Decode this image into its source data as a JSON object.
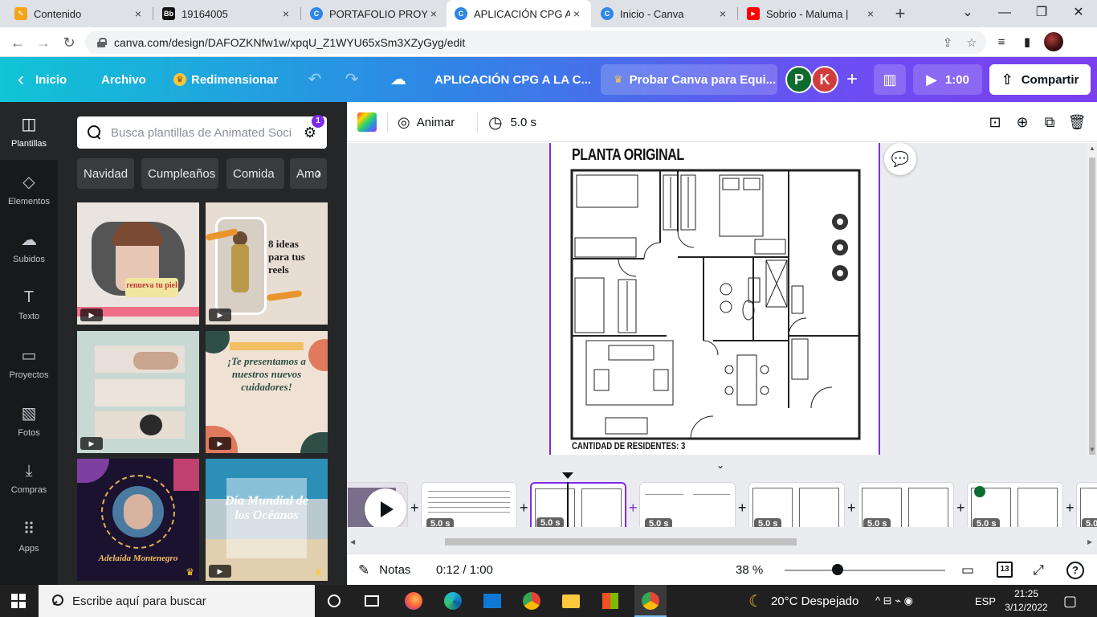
{
  "browser": {
    "tabs": [
      {
        "title": "Contenido",
        "favicon": "pencil-favicon",
        "color": "#f4a31b"
      },
      {
        "title": "19164005",
        "favicon": "bb-favicon",
        "color": "#111111"
      },
      {
        "title": "PORTAFOLIO PROYEC",
        "favicon": "canva-favicon",
        "color": "#2f86e6"
      },
      {
        "title": "APLICACIÓN CPG A LA",
        "favicon": "canva-favicon",
        "color": "#2f86e6",
        "active": true
      },
      {
        "title": "Inicio - Canva",
        "favicon": "canva-favicon",
        "color": "#2f86e6"
      },
      {
        "title": "Sobrio - Maluma |",
        "favicon": "youtube-favicon",
        "color": "#ff0000"
      }
    ],
    "favicon_letters": {
      "bb": "Bb",
      "canva": "C",
      "youtube": "▶",
      "pencil": "✎"
    },
    "tab_close": "×",
    "new_tab": "+",
    "url": "canva.com/design/DAFOZKNfw1w/xpqU_Z1WYU65xSm3XZyGyg/edit",
    "window_controls": {
      "dropdown": "⌄",
      "minimize": "—",
      "maximize": "❐",
      "close": "✕"
    },
    "nav": {
      "back": "←",
      "forward": "→",
      "reload": "↻"
    },
    "omnibox_icons": {
      "share": "⇪",
      "star": "☆"
    },
    "extensions": {
      "media": "≡",
      "sidepanel": "▮"
    }
  },
  "header": {
    "back_label": "Inicio",
    "back_arrow": "‹",
    "file_label": "Archivo",
    "resize_label": "Redimensionar",
    "crown": "♛",
    "undo": "↶",
    "redo": "↷",
    "cloud": "☁",
    "design_title": "APLICACIÓN CPG A LA C...",
    "try_label": "Probar Canva para Equi...",
    "avatars": [
      {
        "letter": "P",
        "color": "#0e6b2f"
      },
      {
        "letter": "K",
        "color": "#d13c3c"
      }
    ],
    "add_people": "+",
    "stats_icon": "▥",
    "play_time": "1:00",
    "play_icon": "▶",
    "share_label": "Compartir",
    "share_icon": "⇧"
  },
  "rail": {
    "items": [
      {
        "label": "Plantillas",
        "icon": "◫",
        "active": true
      },
      {
        "label": "Elementos",
        "icon": "◇"
      },
      {
        "label": "Subidos",
        "icon": "☁"
      },
      {
        "label": "Texto",
        "icon": "T"
      },
      {
        "label": "Proyectos",
        "icon": "▭"
      },
      {
        "label": "Fotos",
        "icon": "▧"
      },
      {
        "label": "Compras",
        "icon": "⤓"
      },
      {
        "label": "Apps",
        "icon": "⠿"
      }
    ]
  },
  "panel": {
    "search_placeholder": "Busca plantillas de Animated Soci",
    "filter_icon": "⚙",
    "filter_badge": "1",
    "chips": [
      "Navidad",
      "Cumpleaños",
      "Comida",
      "Amo"
    ],
    "chip_arrow": "›",
    "video_icon": "▶",
    "pro_icon": "♛",
    "templates": [
      {
        "text": "renueva tu piel",
        "bg": "#e9e4df"
      },
      {
        "text": "8 ideas para tus reels",
        "bg": "#e8ddd2"
      },
      {
        "text": "",
        "bg": "#c8d8d3"
      },
      {
        "text": "¡Te presentamos a nuestros nuevos cuidadores!",
        "bg": "#efe2d4"
      },
      {
        "text": "Adelaida Montenegro",
        "bg": "#1b1230"
      },
      {
        "text": "Día Mundial de los Océanos",
        "bg": "#b9c9cf"
      }
    ],
    "collapse_arrow": "‹"
  },
  "toolbar": {
    "animate_label": "Animar",
    "animate_icon": "◎",
    "duration": "5.0 s",
    "clock_icon": "◷",
    "lock_icon": "⊡",
    "add_page_icon": "⊕",
    "duplicate_icon": "⧉",
    "delete_icon": "🗑"
  },
  "canvas": {
    "plan_title": "PLANTA ORIGINAL",
    "plan_caption": "CANTIDAD DE RESIDENTES: 3",
    "comment_icon": "💬",
    "scroll_up": "▲",
    "scroll_down": "▼"
  },
  "timeline": {
    "collapse_arrow": "⌄",
    "scenes": [
      {
        "duration": "5.0 s"
      },
      {
        "duration": "5.0 s",
        "active": true
      },
      {
        "duration": "5.0 s"
      },
      {
        "duration": "5.0 s"
      },
      {
        "duration": "5.0 s"
      },
      {
        "duration": "5.0 s"
      },
      {
        "duration": "5.0"
      }
    ],
    "add_icon": "+",
    "scroll_left": "◀",
    "scroll_right": "▶"
  },
  "bottom": {
    "notes_label": "Notas",
    "notes_icon": "✎",
    "time_label": "0:12 / 1:00",
    "zoom_label": "38 %",
    "zoom_value": 0.38,
    "page_count": "13",
    "grid_icon": "▭",
    "fullscreen_icon": "⤢",
    "help_icon": "?"
  },
  "taskbar": {
    "search_text": "Escribe aquí para buscar",
    "weather": "20°C  Despejado",
    "weather_icon": "☾",
    "language": "ESP",
    "time": "21:25",
    "date": "3/12/2022",
    "tray_icons": "^  ⊟  ⌁  ◉",
    "notification_icon": "▢",
    "apps": [
      "cortana-icon",
      "task-view-icon",
      "firefox-icon",
      "edge-icon",
      "mail-icon",
      "chrome-icon",
      "explorer-icon",
      "store-icon",
      "chrome-profile-icon"
    ]
  }
}
